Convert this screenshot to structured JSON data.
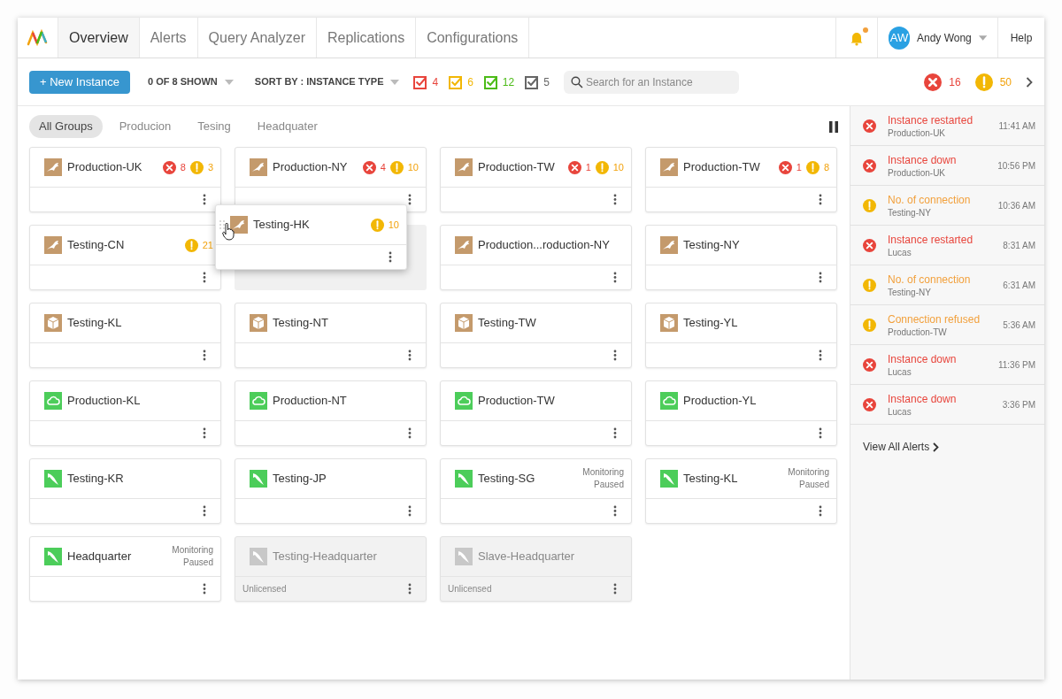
{
  "nav": {
    "tabs": [
      {
        "label": "Overview",
        "selected": true
      },
      {
        "label": "Alerts",
        "selected": false
      },
      {
        "label": "Query Analyzer",
        "selected": false
      },
      {
        "label": "Replications",
        "selected": false
      },
      {
        "label": "Configurations",
        "selected": false
      }
    ],
    "notifications": {
      "unread": true
    },
    "user": {
      "initials": "AW",
      "name": "Andy Wong"
    },
    "help": "Help"
  },
  "toolbar": {
    "new_button": "+ New Instance",
    "shown": "0 OF 8 SHOWN",
    "sort": "SORT BY : INSTANCE TYPE",
    "filters": [
      {
        "count": "4",
        "color": "#e8453c",
        "checked": true
      },
      {
        "count": "6",
        "color": "#f2b705",
        "checked": true
      },
      {
        "count": "12",
        "color": "#4cbb17",
        "checked": true
      },
      {
        "count": "5",
        "color": "#666666",
        "checked": true
      }
    ],
    "search": {
      "placeholder": "Search for an Instance"
    },
    "totals": {
      "errors": "16",
      "warnings": "50"
    }
  },
  "groups": [
    {
      "label": "All Groups",
      "selected": true
    },
    {
      "label": "Producion",
      "selected": false
    },
    {
      "label": "Tesing",
      "selected": false
    },
    {
      "label": "Headquater",
      "selected": false
    }
  ],
  "cards": [
    {
      "kind": "bird",
      "name": "Production-UK",
      "errors": "8",
      "warnings": "3",
      "licensed": true
    },
    {
      "kind": "bird",
      "name": "Production-NY",
      "errors": "4",
      "warnings": "10",
      "licensed": true
    },
    {
      "kind": "bird",
      "name": "Production-TW",
      "errors": "1",
      "warnings": "10",
      "licensed": true
    },
    {
      "kind": "bird",
      "name": "Production-TW",
      "errors": "1",
      "warnings": "8",
      "licensed": true
    },
    {
      "kind": "bird",
      "name": "Testing-CN",
      "warnings": "21",
      "licensed": true
    },
    {
      "kind": "placeholder"
    },
    {
      "kind": "bird",
      "name": "Production...roduction-NY",
      "licensed": true
    },
    {
      "kind": "bird",
      "name": "Testing-NY",
      "licensed": true
    },
    {
      "kind": "box",
      "name": "Testing-KL",
      "licensed": true
    },
    {
      "kind": "box",
      "name": "Testing-NT",
      "licensed": true
    },
    {
      "kind": "box",
      "name": "Testing-TW",
      "licensed": true
    },
    {
      "kind": "box",
      "name": "Testing-YL",
      "licensed": true
    },
    {
      "kind": "cloud",
      "name": "Production-KL",
      "licensed": true
    },
    {
      "kind": "cloud",
      "name": "Production-NT",
      "licensed": true
    },
    {
      "kind": "cloud",
      "name": "Production-TW",
      "licensed": true
    },
    {
      "kind": "cloud",
      "name": "Production-YL",
      "licensed": true
    },
    {
      "kind": "dolphin",
      "name": "Testing-KR",
      "licensed": true
    },
    {
      "kind": "dolphin",
      "name": "Testing-JP",
      "licensed": true
    },
    {
      "kind": "dolphin",
      "name": "Testing-SG",
      "status": "Monitoring Paused",
      "licensed": true
    },
    {
      "kind": "dolphin",
      "name": "Testing-KL",
      "status": "Monitoring Paused",
      "licensed": true
    },
    {
      "kind": "dolphin",
      "name": "Headquarter",
      "status": "Monitoring Paused",
      "licensed": true
    },
    {
      "kind": "dolphin",
      "name": "Testing-Headquarter",
      "licensed": false,
      "note": "Unlicensed"
    },
    {
      "kind": "dolphin",
      "name": "Slave-Headquarter",
      "licensed": false,
      "note": "Unlicensed"
    }
  ],
  "dragged_card": {
    "kind": "bird",
    "name": "Testing-HK",
    "warnings": "10"
  },
  "alerts": [
    {
      "kind": "error",
      "title": "Instance restarted",
      "source": "Production-UK",
      "time": "11:41 AM"
    },
    {
      "kind": "error",
      "title": "Instance down",
      "source": "Production-UK",
      "time": "10:56 PM"
    },
    {
      "kind": "warning",
      "title": "No. of connection",
      "source": "Testing-NY",
      "time": "10:36 AM"
    },
    {
      "kind": "error",
      "title": "Instance restarted",
      "source": "Lucas",
      "time": "8:31 AM"
    },
    {
      "kind": "warning",
      "title": "No. of connection",
      "source": "Testing-NY",
      "time": "6:31 AM"
    },
    {
      "kind": "warning",
      "title": "Connection refused",
      "source": "Production-TW",
      "time": "5:36 AM"
    },
    {
      "kind": "error",
      "title": "Instance down",
      "source": "Lucas",
      "time": "11:36 PM"
    },
    {
      "kind": "error",
      "title": "Instance down",
      "source": "Lucas",
      "time": "3:36 PM"
    }
  ],
  "view_all": "View All Alerts"
}
